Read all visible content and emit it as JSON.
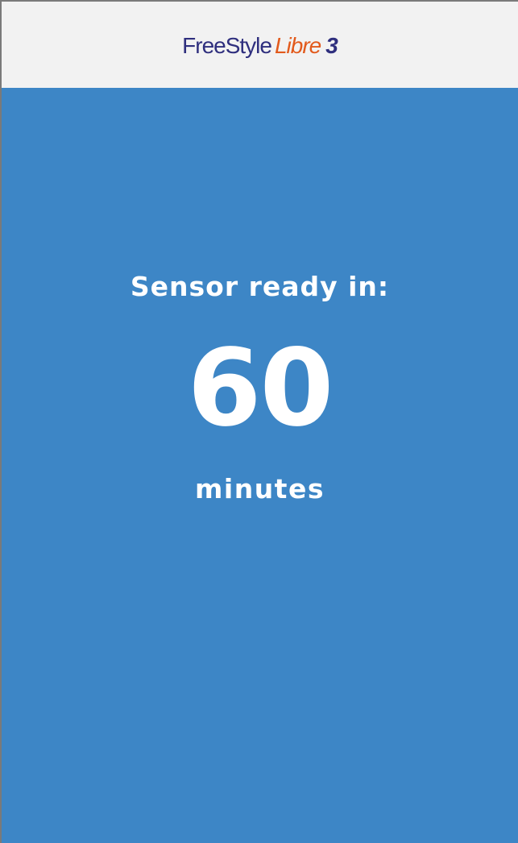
{
  "header": {
    "logo": {
      "part1": "FreeStyle",
      "part2": "Libre",
      "part3": "3"
    }
  },
  "status": {
    "label": "Sensor ready in:",
    "value": "60",
    "unit": "minutes"
  },
  "colors": {
    "header_bg": "#f2f2f2",
    "main_bg": "#3d86c6",
    "logo_blue": "#2f2f7e",
    "logo_orange": "#e25a1c",
    "text": "#ffffff"
  }
}
